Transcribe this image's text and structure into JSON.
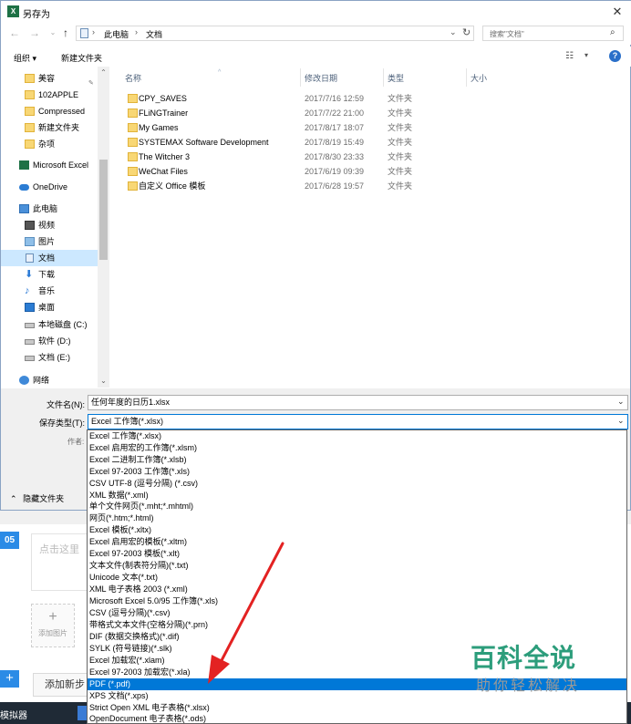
{
  "window": {
    "title": "另存为",
    "app_icon_text": "X"
  },
  "address": {
    "crumbs": [
      "此电脑",
      "文档"
    ],
    "search_placeholder": "搜索\"文档\""
  },
  "toolbar": {
    "organize": "组织 ▾",
    "new_folder": "新建文件夹"
  },
  "nav": {
    "items": [
      {
        "label": "美容",
        "icon": "folder-icon"
      },
      {
        "label": "102APPLE",
        "icon": "folder-icon"
      },
      {
        "label": "Compressed",
        "icon": "folder-icon"
      },
      {
        "label": "新建文件夹",
        "icon": "folder-icon"
      },
      {
        "label": "杂项",
        "icon": "folder-icon"
      },
      {
        "label": "Microsoft Excel",
        "icon": "excel-icon"
      },
      {
        "label": "OneDrive",
        "icon": "onedrive-icon"
      },
      {
        "label": "此电脑",
        "icon": "computer-icon"
      },
      {
        "label": "视频",
        "icon": "video-icon"
      },
      {
        "label": "图片",
        "icon": "pictures-icon"
      },
      {
        "label": "文档",
        "icon": "documents-icon"
      },
      {
        "label": "下载",
        "icon": "downloads-icon"
      },
      {
        "label": "音乐",
        "icon": "music-icon"
      },
      {
        "label": "桌面",
        "icon": "desktop-icon"
      },
      {
        "label": "本地磁盘 (C:)",
        "icon": "drive-icon"
      },
      {
        "label": "软件 (D:)",
        "icon": "drive-icon"
      },
      {
        "label": "文档 (E:)",
        "icon": "drive-icon"
      },
      {
        "label": "网络",
        "icon": "network-icon"
      }
    ]
  },
  "columns": {
    "name": "名称",
    "date": "修改日期",
    "type": "类型",
    "size": "大小"
  },
  "files": [
    {
      "name": "CPY_SAVES",
      "date": "2017/7/16 12:59",
      "type": "文件夹"
    },
    {
      "name": "FLiNGTrainer",
      "date": "2017/7/22 21:00",
      "type": "文件夹"
    },
    {
      "name": "My Games",
      "date": "2017/8/17 18:07",
      "type": "文件夹"
    },
    {
      "name": "SYSTEMAX Software Development",
      "date": "2017/8/19 15:49",
      "type": "文件夹"
    },
    {
      "name": "The Witcher 3",
      "date": "2017/8/30 23:33",
      "type": "文件夹"
    },
    {
      "name": "WeChat Files",
      "date": "2017/6/19 09:39",
      "type": "文件夹"
    },
    {
      "name": "自定义 Office 模板",
      "date": "2017/6/28 19:57",
      "type": "文件夹"
    }
  ],
  "save": {
    "filename_label": "文件名(N):",
    "filename_value": "任何年度的日历1.xlsx",
    "type_label": "保存类型(T):",
    "type_value": "Excel 工作簿(*.xlsx)",
    "author_label": "作者:",
    "hide_folders": "隐藏文件夹"
  },
  "type_options": [
    "Excel 工作簿(*.xlsx)",
    "Excel 启用宏的工作簿(*.xlsm)",
    "Excel 二进制工作簿(*.xlsb)",
    "Excel 97-2003 工作簿(*.xls)",
    "CSV UTF-8 (逗号分隔) (*.csv)",
    "XML 数据(*.xml)",
    "单个文件网页(*.mht;*.mhtml)",
    "网页(*.htm;*.html)",
    "Excel 模板(*.xltx)",
    "Excel 启用宏的模板(*.xltm)",
    "Excel 97-2003 模板(*.xlt)",
    "文本文件(制表符分隔)(*.txt)",
    "Unicode 文本(*.txt)",
    "XML 电子表格 2003 (*.xml)",
    "Microsoft Excel 5.0/95 工作簿(*.xls)",
    "CSV (逗号分隔)(*.csv)",
    "带格式文本文件(空格分隔)(*.prn)",
    "DIF (数据交换格式)(*.dif)",
    "SYLK (符号链接)(*.slk)",
    "Excel 加载宏(*.xlam)",
    "Excel 97-2003 加载宏(*.xla)",
    "PDF (*.pdf)",
    "XPS 文档(*.xps)",
    "Strict Open XML 电子表格(*.xlsx)",
    "OpenDocument 电子表格(*.ods)"
  ],
  "selected_option_index": 21,
  "background": {
    "step_number": "05",
    "textarea_placeholder": "点击这里",
    "add_image": "添加图片",
    "add_step": "添加新步",
    "taskbar_label": "模拟器"
  },
  "watermark": {
    "title": "百科全说",
    "subtitle": "助你轻松解决"
  },
  "colors": {
    "accent": "#0078d7",
    "selection": "#cce8ff",
    "watermark": "#2c9d7b"
  }
}
